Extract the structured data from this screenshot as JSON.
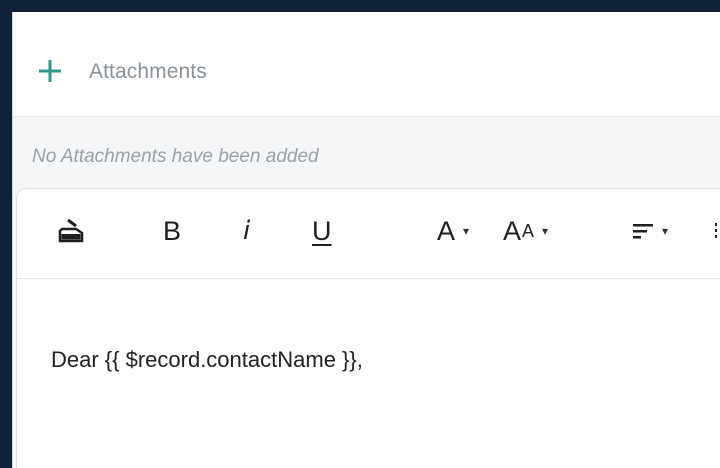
{
  "attachments": {
    "add_icon": "plus-icon",
    "label": "Attachments",
    "empty_message": "No Attachments have been added"
  },
  "editor": {
    "toolbar": {
      "clear_format_icon": "clear-format-icon",
      "bold_label": "B",
      "italic_label": "i",
      "underline_label": "U",
      "font_color_label": "A",
      "font_size_label_big": "A",
      "font_size_label_small": "A",
      "align_icon": "align-left-icon",
      "dropdown_icon": "caret-down-icon",
      "caret_glyph": "▾"
    },
    "content": "Dear {{ $record.contactName }},"
  },
  "colors": {
    "accent": "#2e9a8c",
    "background": "#0f2238",
    "muted_text": "#8a9197"
  }
}
